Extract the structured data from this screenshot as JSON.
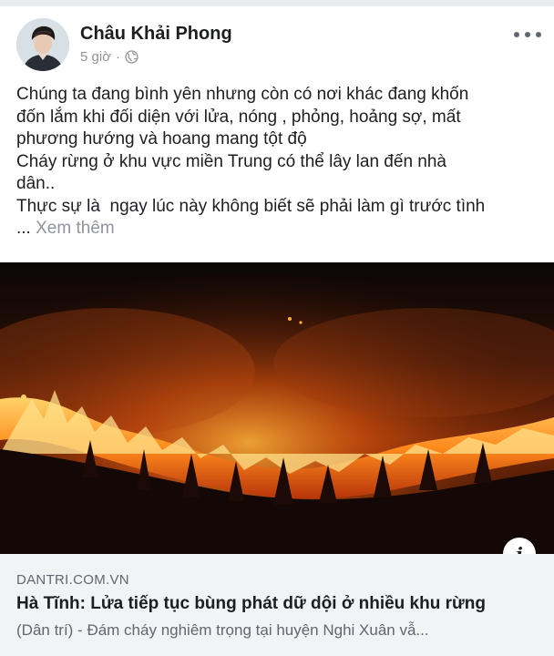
{
  "post": {
    "author": "Châu Khải Phong",
    "time": "5 giờ",
    "separator": "·",
    "privacy_icon": "globe-icon",
    "more_icon": "more-options-icon",
    "text_lines": [
      "Chúng ta đang bình yên nhưng còn có nơi khác đang khốn",
      "đốn lắm khi đối diện với lửa, nóng , phỏng, hoảng sợ, mất",
      "phương hướng và hoang mang tột độ",
      "Cháy rừng ở khu vực miền Trung có thể lây lan đến nhà",
      "dân..",
      "Thực sự là  ngay lúc này không biết sẽ phải làm gì trước tình"
    ],
    "ellipsis": "...",
    "see_more": "Xem thêm"
  },
  "link_preview": {
    "info_icon": "info-icon",
    "info_glyph": "i",
    "domain": "DANTRI.COM.VN",
    "title": "Hà Tĩnh: Lửa tiếp tục bùng phát dữ dội ở nhiều khu rừng",
    "description": "(Dân trí) - Đám cháy nghiêm trọng tại huyện Nghi Xuân vẫ..."
  },
  "colors": {
    "text": "#1c1e21",
    "secondary": "#90949c",
    "link_box_bg": "#f2f3f5"
  }
}
